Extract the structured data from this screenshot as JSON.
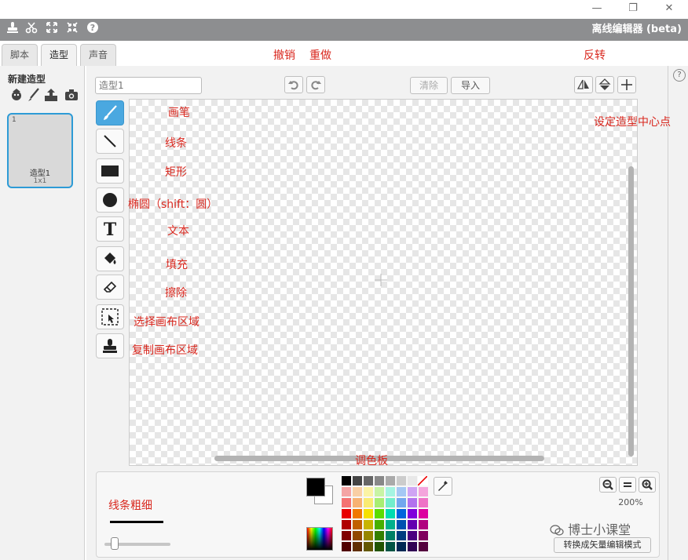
{
  "app": {
    "title": "离线编辑器 (beta)"
  },
  "window": {
    "minimize": "—",
    "restore": "❐",
    "close": "✕"
  },
  "menubar_icons": [
    "stamp-icon",
    "cut-icon",
    "grow-icon",
    "shrink-icon",
    "help-icon"
  ],
  "tabs": [
    {
      "label": "脚本",
      "active": false
    },
    {
      "label": "造型",
      "active": true
    },
    {
      "label": "声音",
      "active": false
    }
  ],
  "left_panel": {
    "new_costume_label": "新建造型",
    "new_costume_icons": [
      "sprite-library-icon",
      "paint-brush-icon",
      "upload-icon",
      "camera-icon"
    ],
    "costume": {
      "number": "1",
      "name": "造型1",
      "size": "1x1"
    }
  },
  "editor": {
    "name_placeholder": "造型1",
    "clear_label": "清除",
    "import_label": "导入",
    "tools": [
      {
        "name": "brush",
        "icon": "brush-icon",
        "active": true
      },
      {
        "name": "line",
        "icon": "line-icon",
        "active": false
      },
      {
        "name": "rectangle",
        "icon": "rectangle-icon",
        "active": false
      },
      {
        "name": "ellipse",
        "icon": "ellipse-icon",
        "active": false
      },
      {
        "name": "text",
        "icon": "text-icon",
        "active": false
      },
      {
        "name": "fill",
        "icon": "fill-bucket-icon",
        "active": false
      },
      {
        "name": "eraser",
        "icon": "eraser-icon",
        "active": false
      },
      {
        "name": "select",
        "icon": "select-icon",
        "active": false
      },
      {
        "name": "stamp",
        "icon": "stamp-icon",
        "active": false
      }
    ],
    "zoom_level": "200%",
    "convert_label": "转换成矢量编辑模式"
  },
  "palette": {
    "foreground": "#000000",
    "background": "#ffffff",
    "colors": [
      [
        "#000000",
        "#444444",
        "#666666",
        "#888888",
        "#aaaaaa",
        "#cccccc",
        "#e8e8e8",
        "#ffffff"
      ],
      [
        "#f4a4a4",
        "#f9cfa4",
        "#fbf3a4",
        "#c8f4a4",
        "#a4f4e2",
        "#a4c8f4",
        "#cfa4f4",
        "#f4a4dc"
      ],
      [
        "#f47272",
        "#f7b272",
        "#f9eb72",
        "#a8ee72",
        "#72eecc",
        "#72a8ee",
        "#b272ee",
        "#ee72c6"
      ],
      [
        "#e80000",
        "#f07800",
        "#f5e000",
        "#5cdc00",
        "#00dcb0",
        "#0064dc",
        "#8000dc",
        "#dc00a0"
      ],
      [
        "#b00000",
        "#c06000",
        "#c8b400",
        "#48b000",
        "#00b08c",
        "#0050b0",
        "#6400b0",
        "#b00080"
      ],
      [
        "#800000",
        "#904800",
        "#968600",
        "#348000",
        "#008066",
        "#003c80",
        "#4a0080",
        "#80005e"
      ],
      [
        "#500000",
        "#602e00",
        "#645800",
        "#225400",
        "#005444",
        "#002854",
        "#300054",
        "#54003e"
      ]
    ]
  },
  "annotations": {
    "undo": "撤销",
    "redo": "重做",
    "flip": "反转",
    "set_center": "设定造型中心点",
    "brush": "画笔",
    "line": "线条",
    "rectangle": "矩形",
    "ellipse": "椭圆（shift：圆）",
    "text": "文本",
    "fill": "填充",
    "erase": "擦除",
    "select": "选择画布区域",
    "stamp": "复制画布区域",
    "palette": "调色板",
    "line_width": "线条粗细"
  },
  "watermark": "博士小课堂"
}
